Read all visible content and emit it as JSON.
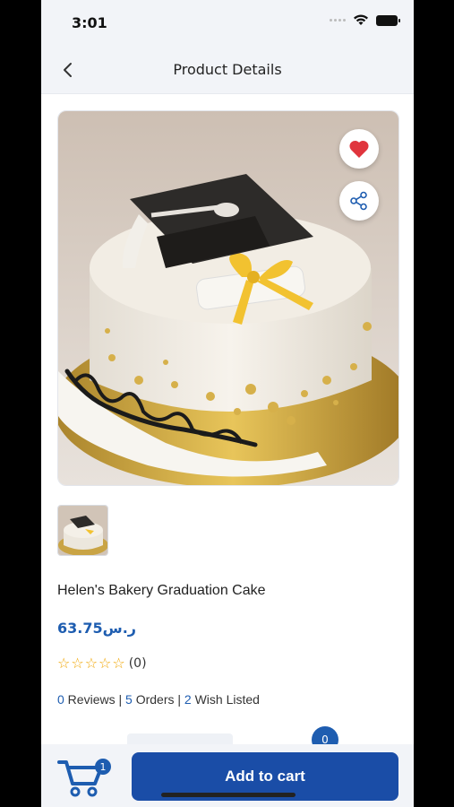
{
  "status_bar": {
    "time": "3:01"
  },
  "nav": {
    "title": "Product Details",
    "back_icon": "chevron-left-icon"
  },
  "product": {
    "name": "Helen's Bakery Graduation Cake",
    "price": "63.75ر.س",
    "rating_count": "(0)",
    "stars_filled": 0,
    "stars_total": 5
  },
  "stats": {
    "reviews_num": "0",
    "reviews_label": " Reviews | ",
    "orders_num": "5",
    "orders_label": " Orders | ",
    "wish_num": "2",
    "wish_label": " Wish Listed"
  },
  "quantity_badge": "0",
  "cart": {
    "badge": "1",
    "add_label": "Add to cart"
  },
  "colors": {
    "accent": "#1e5db0",
    "button": "#1a4da7",
    "heart": "#e0353d",
    "star": "#f0a500"
  }
}
